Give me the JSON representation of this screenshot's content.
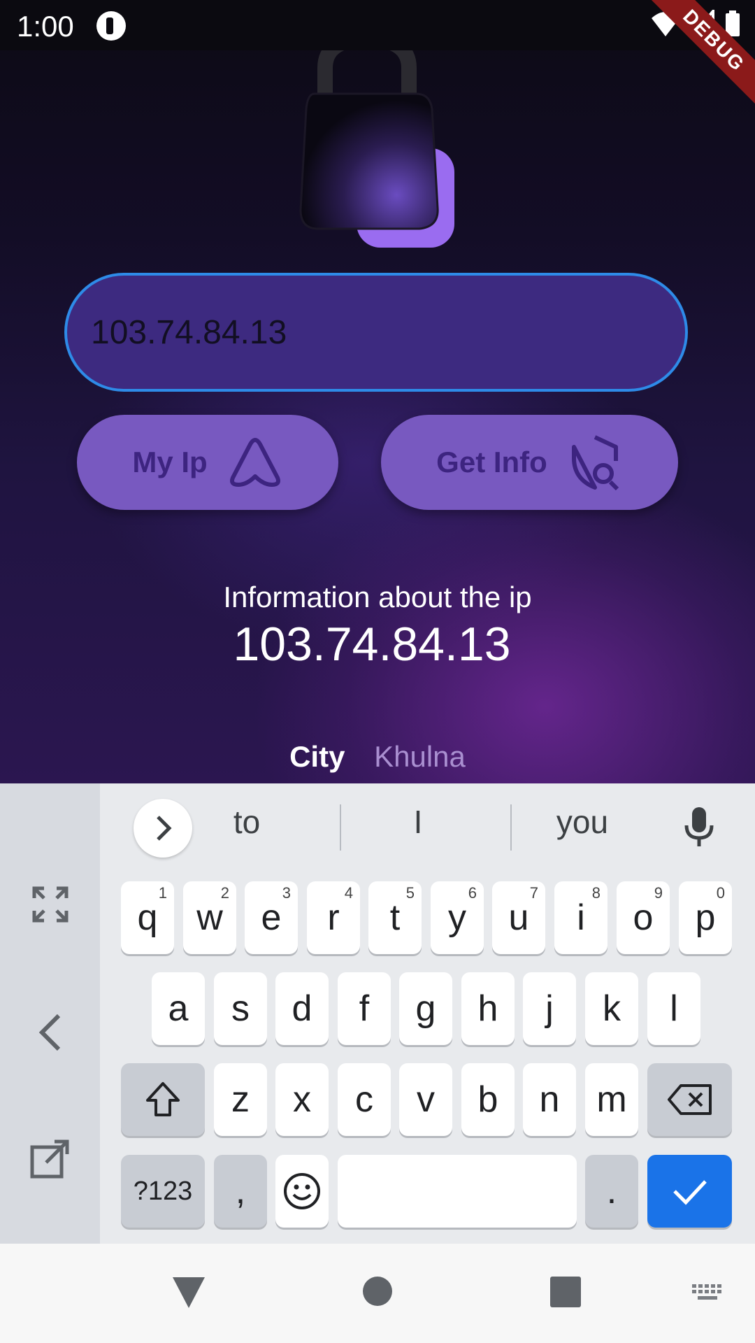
{
  "status_bar": {
    "time": "1:00"
  },
  "debug_banner": "DEBUG",
  "ip_field": {
    "value": "103.74.84.13"
  },
  "buttons": {
    "my_ip": "My Ip",
    "get_info": "Get Info"
  },
  "info": {
    "label": "Information about the ip",
    "ip": "103.74.84.13"
  },
  "details": {
    "city_key": "City",
    "city_value": "Khulna"
  },
  "keyboard": {
    "suggestions": [
      "to",
      "I",
      "you"
    ],
    "rows": [
      [
        [
          "q",
          "1"
        ],
        [
          "w",
          "2"
        ],
        [
          "e",
          "3"
        ],
        [
          "r",
          "4"
        ],
        [
          "t",
          "5"
        ],
        [
          "y",
          "6"
        ],
        [
          "u",
          "7"
        ],
        [
          "i",
          "8"
        ],
        [
          "o",
          "9"
        ],
        [
          "p",
          "0"
        ]
      ],
      [
        "a",
        "s",
        "d",
        "f",
        "g",
        "h",
        "j",
        "k",
        "l"
      ],
      [
        "z",
        "x",
        "c",
        "v",
        "b",
        "n",
        "m"
      ]
    ],
    "symbols_key": "?123",
    "comma_key": ",",
    "period_key": "."
  },
  "colors": {
    "accent": "#7859c0",
    "input_border": "#2e8be8",
    "keyboard_blue": "#1a73e8"
  }
}
